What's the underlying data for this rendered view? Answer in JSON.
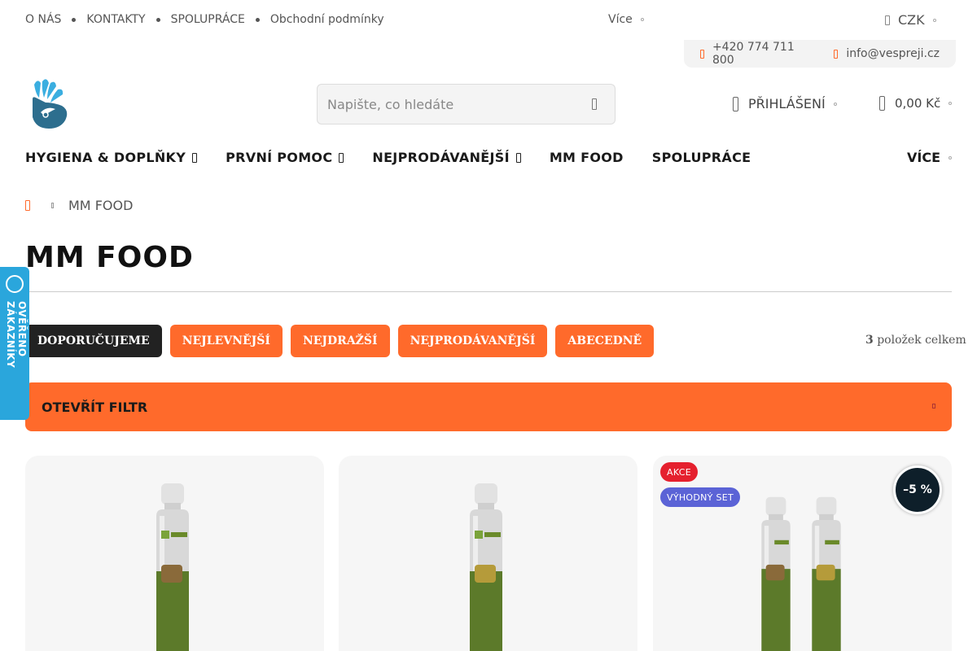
{
  "topbar": {
    "links": [
      "O NÁS",
      "KONTAKTY",
      "SPOLUPRÁCE",
      "Obchodní podmínky"
    ],
    "more_label": "Více",
    "currency": "CZK"
  },
  "contact": {
    "phone": "+420 774 711 800",
    "email": "info@vespreji.cz"
  },
  "search": {
    "placeholder": "Napište, co hledáte"
  },
  "header": {
    "login_label": "PŘIHLÁŠENÍ",
    "cart_total": "0,00 Kč"
  },
  "nav": {
    "items": [
      "HYGIENA & DOPLŇKY",
      "PRVNÍ POMOC",
      "NEJPRODÁVANĚJŠÍ",
      "MM FOOD",
      "SPOLUPRÁCE"
    ],
    "more_label": "VÍCE"
  },
  "breadcrumb": {
    "current": "MM FOOD"
  },
  "page": {
    "title": "MM FOOD"
  },
  "sorting": {
    "options": [
      "DOPORUČUJEME",
      "NEJLEVNĚJŠÍ",
      "NEJDRAŽŠÍ",
      "NEJPRODÁVANĚJŠÍ",
      "ABECEDNĚ"
    ],
    "count_number": "3",
    "count_label": "položek celkem"
  },
  "filter": {
    "label": "OTEVŘÍT FILTR"
  },
  "trust_badge": {
    "label": "OVĚŘENO ZÁKAZNÍKY"
  },
  "products": [
    {
      "badges": []
    },
    {
      "badges": []
    },
    {
      "badges": [
        "AKCE",
        "VÝHODNÝ SET"
      ],
      "discount": "–5 %"
    }
  ],
  "colors": {
    "accent": "#ff6a2b",
    "dark": "#222222",
    "trust": "#2aa6dc",
    "akce": "#e5202e",
    "set": "#5b63d6"
  }
}
